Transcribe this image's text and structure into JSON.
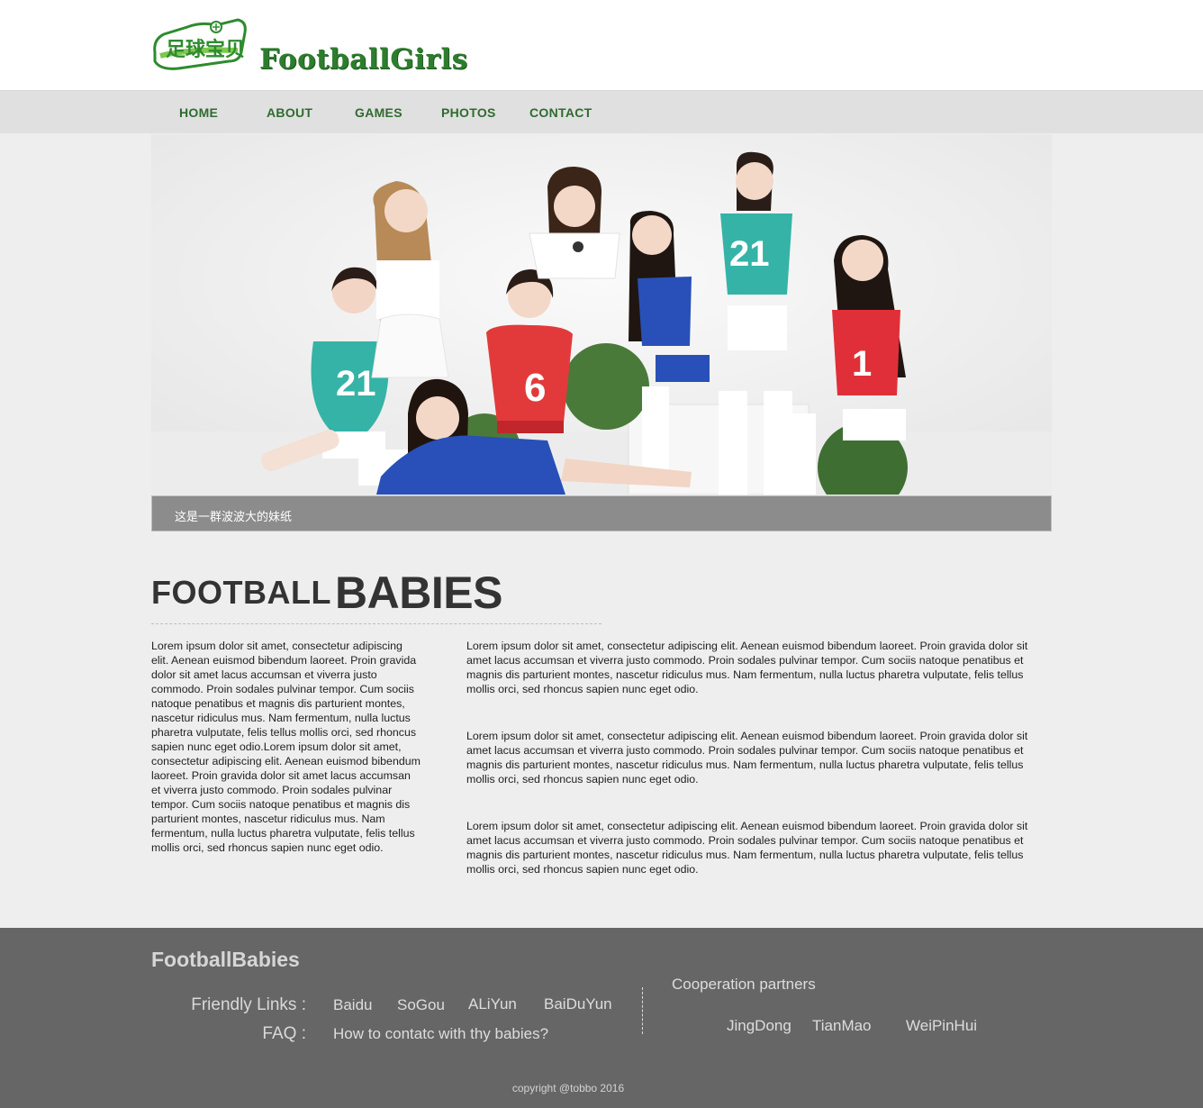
{
  "header": {
    "logo_badge_text": "足球宝贝",
    "site_title": "FootballGirls"
  },
  "nav": {
    "items": [
      {
        "label": "HOME"
      },
      {
        "label": "ABOUT"
      },
      {
        "label": "GAMES"
      },
      {
        "label": "PHOTOS"
      },
      {
        "label": "CONTACT"
      }
    ]
  },
  "hero": {
    "caption": "这是一群波波大的妹纸",
    "jersey_numbers": [
      "21",
      "6",
      "21",
      "1"
    ]
  },
  "main": {
    "heading_part1": "FOOTBALL",
    "heading_part2": "BABIES",
    "left_column": "Lorem ipsum dolor sit amet, consectetur adipiscing elit. Aenean euismod bibendum laoreet. Proin gravida dolor sit amet lacus accumsan et viverra justo commodo. Proin sodales pulvinar tempor. Cum sociis natoque penatibus et magnis dis parturient montes, nascetur ridiculus mus. Nam fermentum, nulla luctus pharetra vulputate, felis tellus mollis orci, sed rhoncus sapien nunc eget odio.Lorem ipsum dolor sit amet, consectetur adipiscing elit. Aenean euismod bibendum laoreet. Proin gravida dolor sit amet lacus accumsan et viverra justo commodo. Proin sodales pulvinar tempor. Cum sociis natoque penatibus et magnis dis parturient montes, nascetur ridiculus mus. Nam fermentum, nulla luctus pharetra vulputate, felis tellus mollis orci, sed rhoncus sapien nunc eget odio.",
    "right_paragraphs": [
      "Lorem ipsum dolor sit amet, consectetur adipiscing elit. Aenean euismod bibendum laoreet. Proin gravida dolor sit amet lacus accumsan et viverra justo commodo. Proin sodales pulvinar tempor. Cum sociis natoque penatibus et magnis dis parturient montes, nascetur ridiculus mus. Nam fermentum, nulla luctus pharetra vulputate, felis tellus mollis orci, sed rhoncus sapien nunc eget odio.",
      "Lorem ipsum dolor sit amet, consectetur adipiscing elit. Aenean euismod bibendum laoreet. Proin gravida dolor sit amet lacus accumsan et viverra justo commodo. Proin sodales pulvinar tempor. Cum sociis natoque penatibus et magnis dis parturient montes, nascetur ridiculus mus. Nam fermentum, nulla luctus pharetra vulputate, felis tellus mollis orci, sed rhoncus sapien nunc eget odio.",
      "Lorem ipsum dolor sit amet, consectetur adipiscing elit. Aenean euismod bibendum laoreet. Proin gravida dolor sit amet lacus accumsan et viverra justo commodo. Proin sodales pulvinar tempor. Cum sociis natoque penatibus et magnis dis parturient montes, nascetur ridiculus mus. Nam fermentum, nulla luctus pharetra vulputate, felis tellus mollis orci, sed rhoncus sapien nunc eget odio."
    ]
  },
  "footer": {
    "brand": "FootballBabies",
    "friendly_label": "Friendly Links :",
    "friendly_links": [
      "Baidu",
      "SoGou",
      "ALiYun",
      "BaiDuYun"
    ],
    "faq_label": "FAQ :",
    "faq_link": "How to contatc with thy babies?",
    "partners_label": "Cooperation partners",
    "partners": [
      "JingDong",
      "TianMao",
      "WeiPinHui"
    ],
    "copyright": "copyright @tobbo 2016"
  },
  "colors": {
    "brand_green": "#2e7d2e",
    "nav_text": "#2f6b2f",
    "footer_bg": "#666666",
    "caption_bg": "#8c8c8c"
  }
}
